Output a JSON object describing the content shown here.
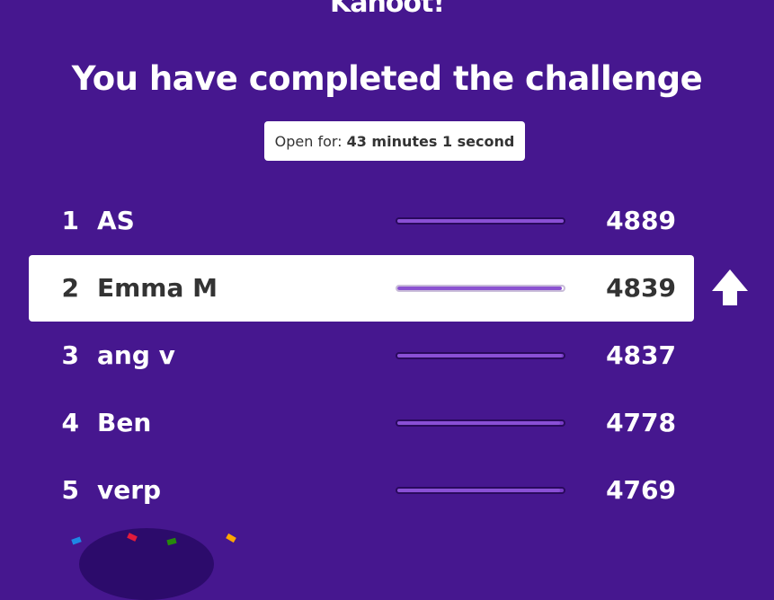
{
  "header": {
    "logo_text": "Kahoot!",
    "title": "You have completed the challenge"
  },
  "timer": {
    "label": "Open for:",
    "value": "43 minutes 1 second"
  },
  "leaderboard": [
    {
      "rank": "1",
      "name": "AS",
      "score": "4889",
      "progress": 1.0,
      "highlighted": false
    },
    {
      "rank": "2",
      "name": "Emma M",
      "score": "4839",
      "progress": 0.99,
      "highlighted": true
    },
    {
      "rank": "3",
      "name": "ang v",
      "score": "4837",
      "progress": 0.99,
      "highlighted": false
    },
    {
      "rank": "4",
      "name": "Ben",
      "score": "4778",
      "progress": 0.98,
      "highlighted": false
    },
    {
      "rank": "5",
      "name": "verp",
      "score": "4769",
      "progress": 0.98,
      "highlighted": false
    }
  ],
  "icons": {
    "rank_change": "arrow-up-icon"
  },
  "colors": {
    "background": "#46178f",
    "highlight_row": "#ffffff",
    "bar_fill": "#8b52d1"
  }
}
